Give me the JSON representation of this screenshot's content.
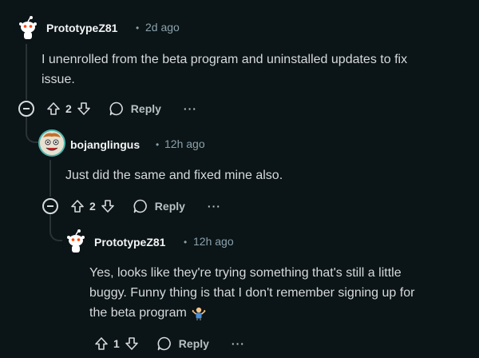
{
  "comments": [
    {
      "author": "PrototypeZ81",
      "separator": "•",
      "time": "2d ago",
      "body_lines": [
        "I unenrolled from the beta program and uninstalled updates to fix",
        "issue."
      ],
      "votes": "2",
      "reply_label": "Reply",
      "more_label": "···"
    },
    {
      "author": "bojanglingus",
      "separator": "•",
      "time": "12h ago",
      "body_lines": [
        "Just did the same and fixed mine also."
      ],
      "votes": "2",
      "reply_label": "Reply",
      "more_label": "···"
    },
    {
      "author": "PrototypeZ81",
      "separator": "•",
      "time": "12h ago",
      "body_lines": [
        "Yes, looks like they're trying something that's still a little",
        "buggy. Funny thing is that I don't remember signing up for",
        "the beta program"
      ],
      "votes": "1",
      "reply_label": "Reply",
      "more_label": "···"
    }
  ],
  "colors": {
    "background": "#0b1416",
    "text": "#d7dadc",
    "muted": "#8ba2ad",
    "thread_line": "#2a3236"
  },
  "icons": [
    "snoo-avatar-icon",
    "upvote-arrow-icon",
    "downvote-arrow-icon",
    "reply-bubble-icon",
    "collapse-minus-icon",
    "shrug-emoji-icon"
  ]
}
